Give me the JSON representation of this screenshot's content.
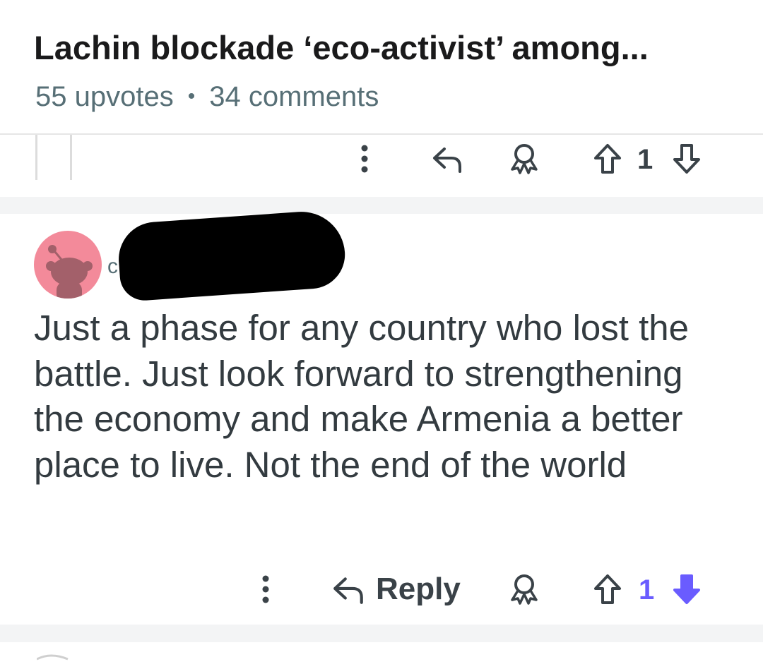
{
  "post": {
    "title": "Lachin blockade ‘eco-activist’ among...",
    "upvotes": "55 upvotes",
    "separator": "•",
    "comments": "34 comments"
  },
  "previous_comment": {
    "vote_count": "1",
    "icons": [
      "more-options-icon",
      "reply-arrow-icon",
      "award-icon",
      "upvote-arrow-icon",
      "downvote-arrow-icon"
    ]
  },
  "comment": {
    "author_initial": "c",
    "author_redacted": true,
    "body": "Just a phase for any country who lost the battle. Just look forward to strengthening the economy and make Armenia a better place to live. Not the end of the world",
    "reply_label": "Reply",
    "vote_count": "1",
    "vote_state": "downvoted"
  },
  "colors": {
    "accent_top": "#f5a623",
    "text_primary": "#1a1a1b",
    "text_meta": "#576f76",
    "icon": "#3a4248",
    "downvote_active": "#6a5cff",
    "avatar_bg": "#f38a9a",
    "gap": "#f3f4f5"
  }
}
